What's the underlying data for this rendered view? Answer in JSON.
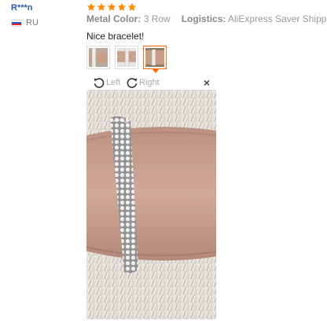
{
  "reviewer": {
    "name": "R***n",
    "country_code": "RU",
    "flag_icon": "russia-flag-icon"
  },
  "rating": {
    "stars": 5,
    "max": 5,
    "color": "#ff8a00"
  },
  "attributes": {
    "metal_color_label": "Metal Color:",
    "metal_color_value": "3 Row",
    "logistics_label": "Logistics:",
    "logistics_value": "AliExpress Saver Shipping"
  },
  "review_text": "Nice bracelet!",
  "thumbnails": [
    {
      "name": "bracelet-photo-thumbnail-1",
      "active": false
    },
    {
      "name": "bracelet-photo-thumbnail-2",
      "active": false
    },
    {
      "name": "bracelet-photo-thumbnail-3",
      "active": true
    }
  ],
  "viewer": {
    "rotate_left_label": "Left",
    "rotate_right_label": "Right",
    "close_label": "×"
  },
  "colors": {
    "accent": "#ff6a00",
    "username": "#2b59a8"
  }
}
